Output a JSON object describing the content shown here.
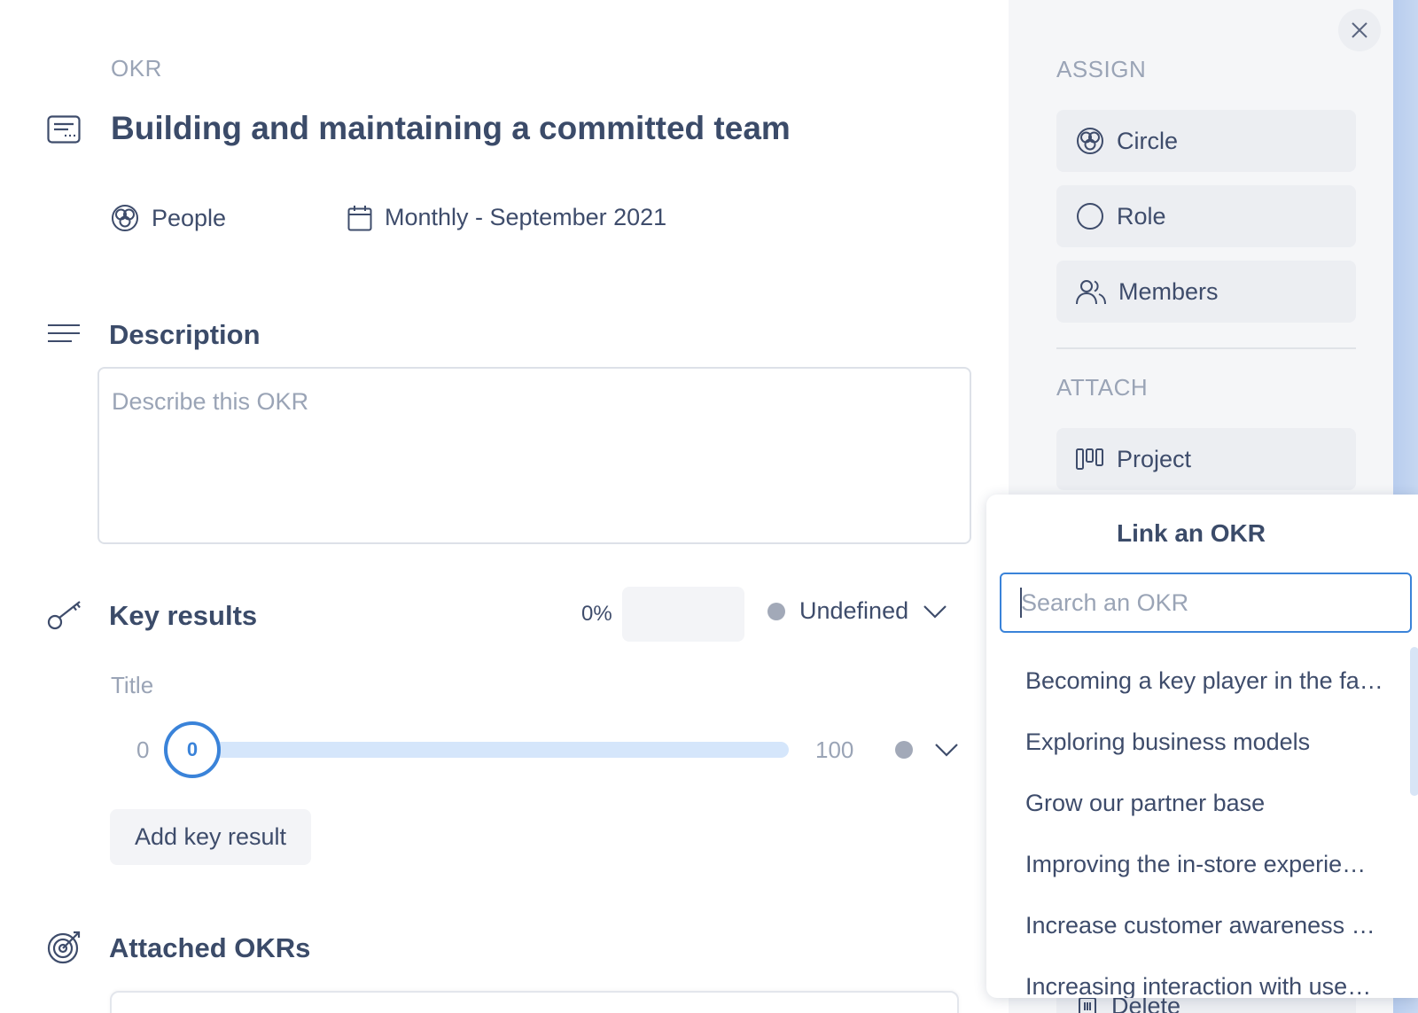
{
  "okr": {
    "overline": "OKR",
    "title": "Building and maintaining a committed team",
    "circle": "People",
    "period": "Monthly - September 2021"
  },
  "description": {
    "heading": "Description",
    "placeholder": "Describe this OKR"
  },
  "key_results": {
    "heading": "Key results",
    "progress_text": "0%",
    "progress": 0,
    "status": "Undefined",
    "title_label": "Title",
    "slider": {
      "min": "0",
      "value": "0",
      "max": "100"
    },
    "add_button": "Add key result"
  },
  "attached": {
    "heading": "Attached OKRs"
  },
  "sidebar": {
    "assign_heading": "ASSIGN",
    "assign_buttons": [
      {
        "label": "Circle",
        "icon": "circle-group-icon"
      },
      {
        "label": "Role",
        "icon": "role-icon"
      },
      {
        "label": "Members",
        "icon": "members-icon"
      }
    ],
    "attach_heading": "ATTACH",
    "attach_buttons": [
      {
        "label": "Project",
        "icon": "project-icon"
      }
    ],
    "delete_label": "Delete"
  },
  "link_popover": {
    "title": "Link an OKR",
    "search_placeholder": "Search an OKR",
    "items": [
      "Becoming a key player in the fa…",
      "Exploring business models",
      "Grow our partner base",
      "Improving the in-store experie…",
      "Increase customer awareness …",
      "Increasing interaction with use…"
    ]
  },
  "colors": {
    "accent": "#3a83d9",
    "text": "#3e4c6b",
    "muted": "#9aa4b6",
    "status_undefined": "#a2a9b8"
  }
}
